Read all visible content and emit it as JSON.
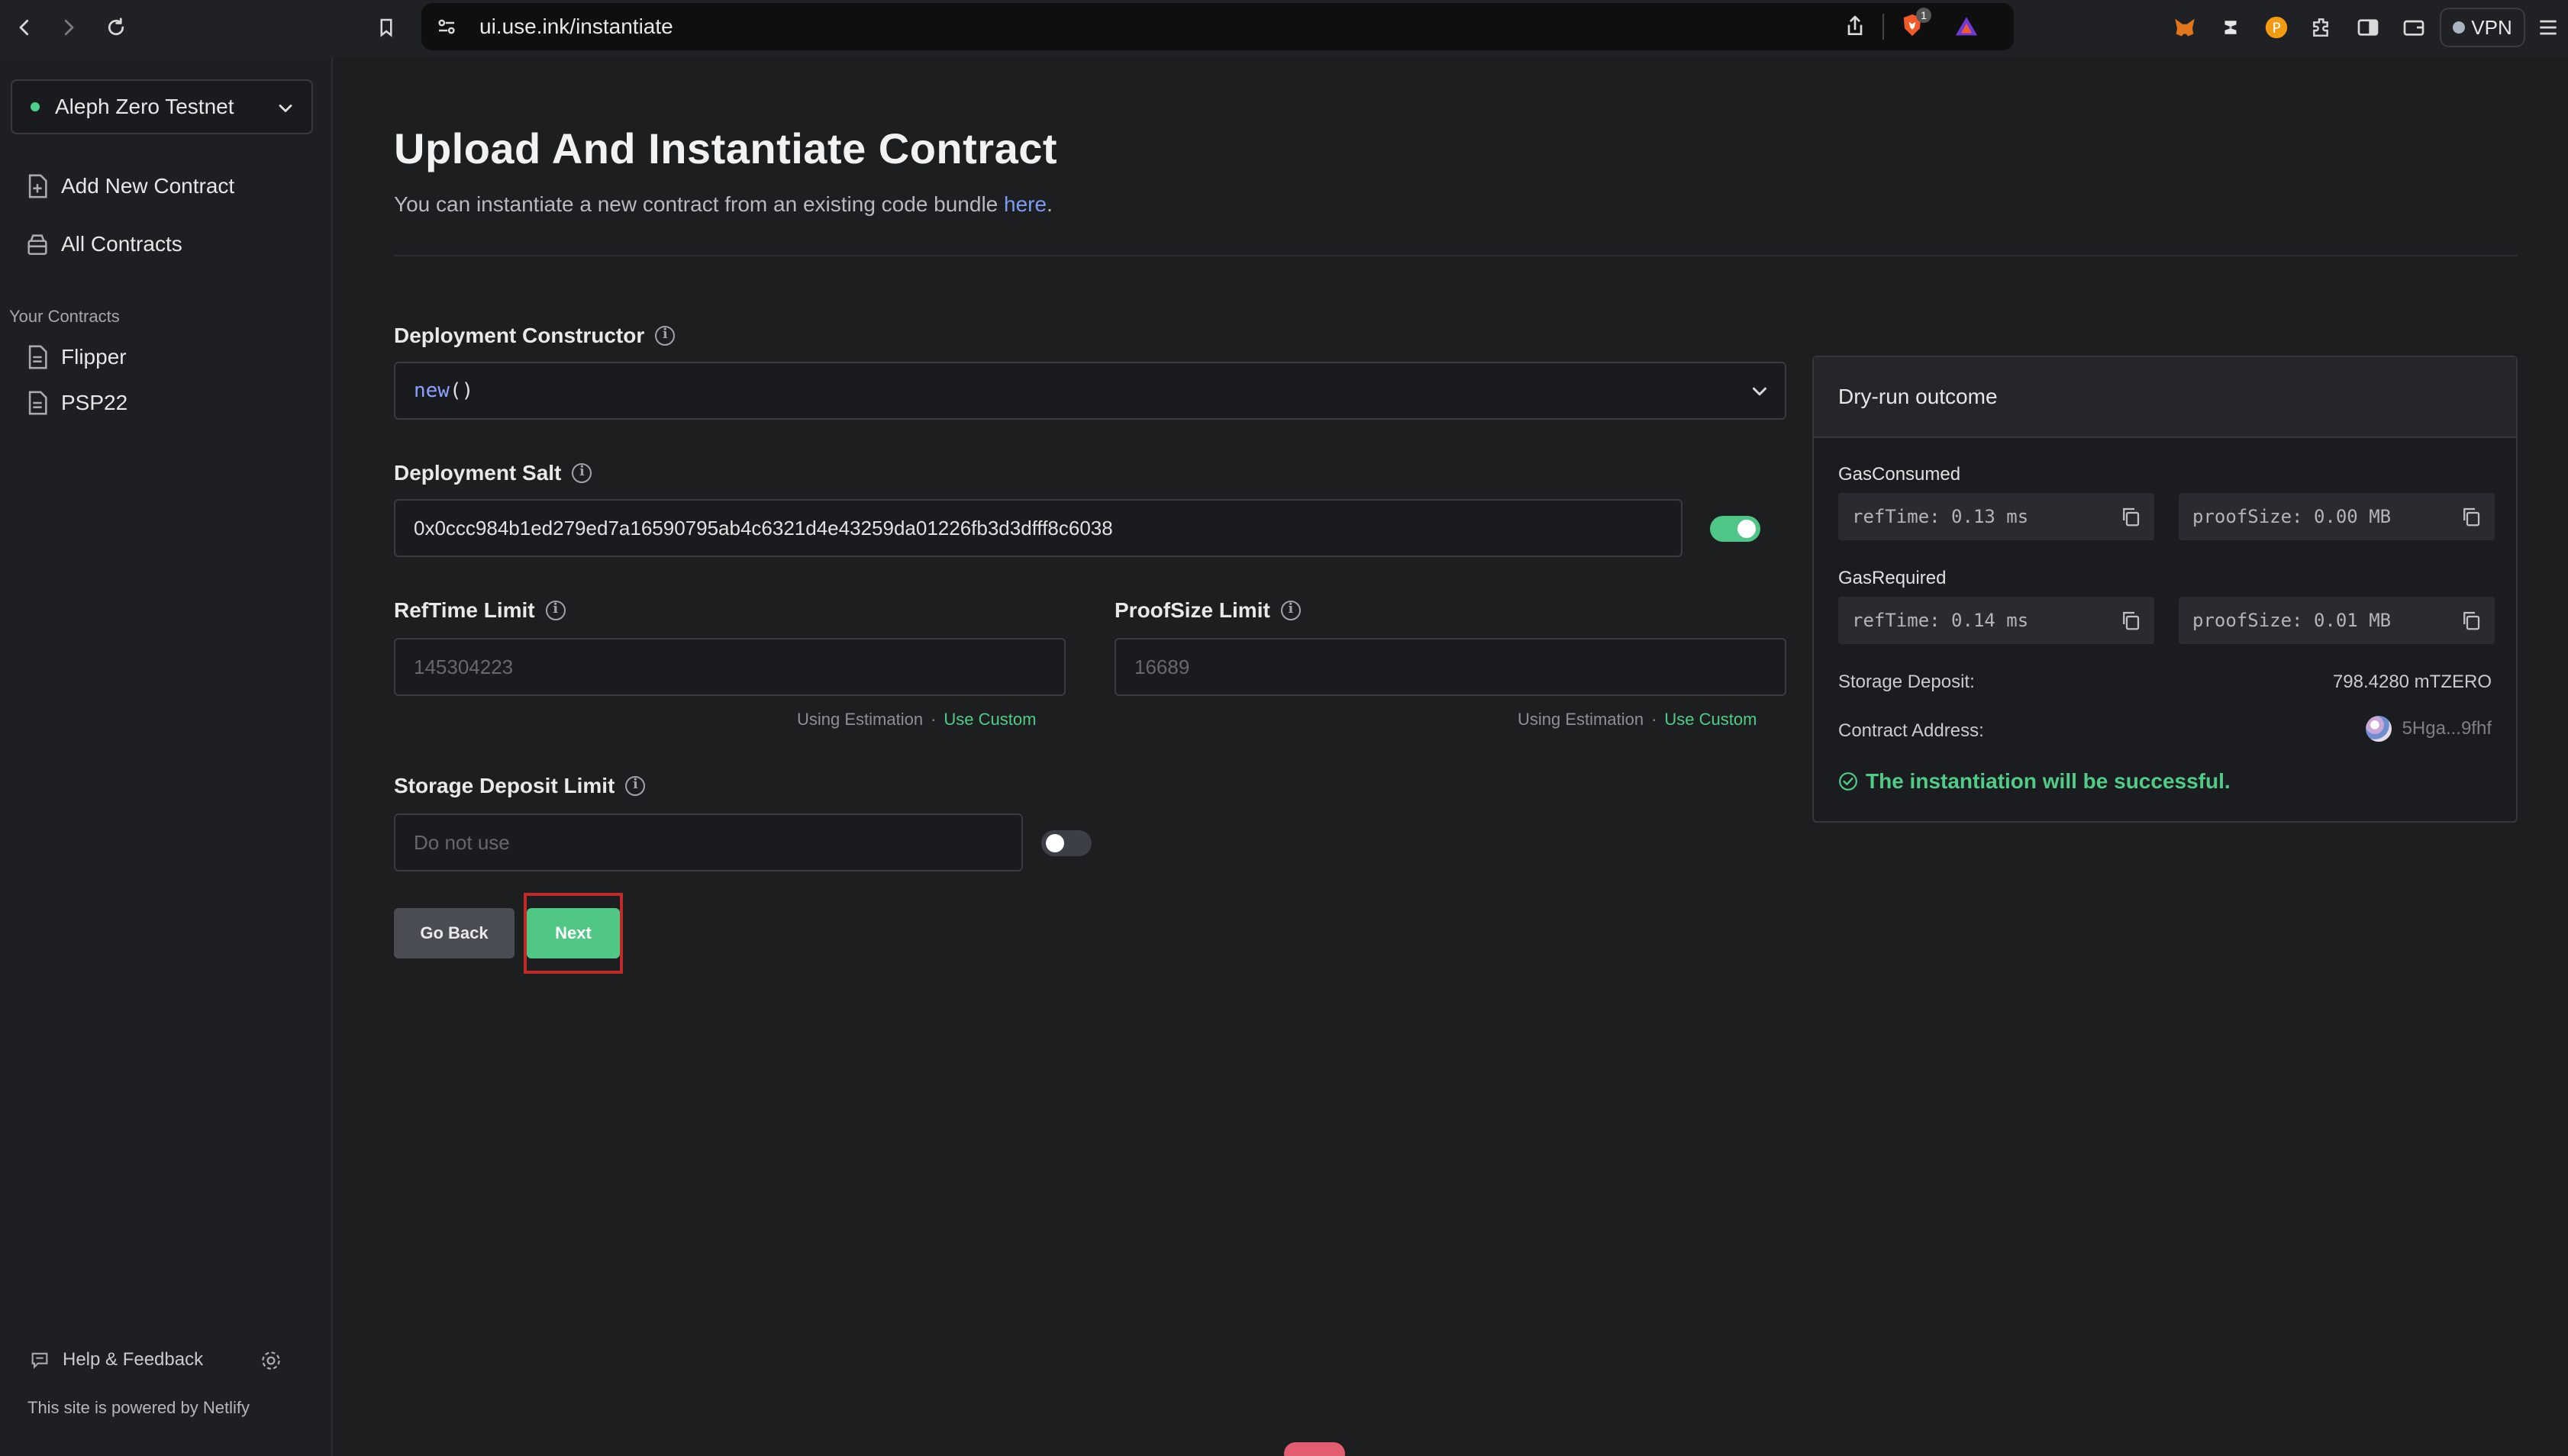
{
  "browser": {
    "url": "ui.use.ink/instantiate",
    "brave_badge": "1",
    "vpn_label": "VPN"
  },
  "sidebar": {
    "network": "Aleph Zero Testnet",
    "nav": [
      {
        "label": "Add New Contract"
      },
      {
        "label": "All Contracts"
      }
    ],
    "your_contracts_label": "Your Contracts",
    "contracts": [
      {
        "label": "Flipper"
      },
      {
        "label": "PSP22"
      }
    ],
    "help_label": "Help & Feedback",
    "powered_by": "This site is powered by Netlify"
  },
  "page": {
    "title": "Upload And Instantiate Contract",
    "subtitle_prefix": "You can instantiate a new contract from an existing code bundle ",
    "subtitle_link": "here",
    "subtitle_suffix": "."
  },
  "form": {
    "constructor_label": "Deployment Constructor",
    "constructor_name": "new",
    "constructor_parens": "()",
    "salt_label": "Deployment Salt",
    "salt_value": "0x0ccc984b1ed279ed7a16590795ab4c6321d4e43259da01226fb3d3dfff8c6038",
    "reftime_label": "RefTime Limit",
    "reftime_placeholder": "145304223",
    "proofsize_label": "ProofSize Limit",
    "proofsize_placeholder": "16689",
    "using_estimation": "Using Estimation",
    "sep": "·",
    "use_custom": "Use Custom",
    "storage_label": "Storage Deposit Limit",
    "storage_placeholder": "Do not use",
    "go_back": "Go Back",
    "next": "Next"
  },
  "dry_run": {
    "title": "Dry-run outcome",
    "gas_consumed_label": "GasConsumed",
    "gas_consumed_reftime": "refTime: 0.13 ms",
    "gas_consumed_proofsize": "proofSize: 0.00 MB",
    "gas_required_label": "GasRequired",
    "gas_required_reftime": "refTime: 0.14 ms",
    "gas_required_proofsize": "proofSize: 0.01 MB",
    "storage_deposit_label": "Storage Deposit:",
    "storage_deposit_value": "798.4280 mTZERO",
    "contract_address_label": "Contract Address:",
    "contract_address_value": "5Hga...9fhf",
    "success_message": "The instantiation will be successful."
  },
  "colors": {
    "accent_green": "#50c784",
    "link_blue": "#7b9cf2",
    "highlight_red": "#c22a2a"
  }
}
